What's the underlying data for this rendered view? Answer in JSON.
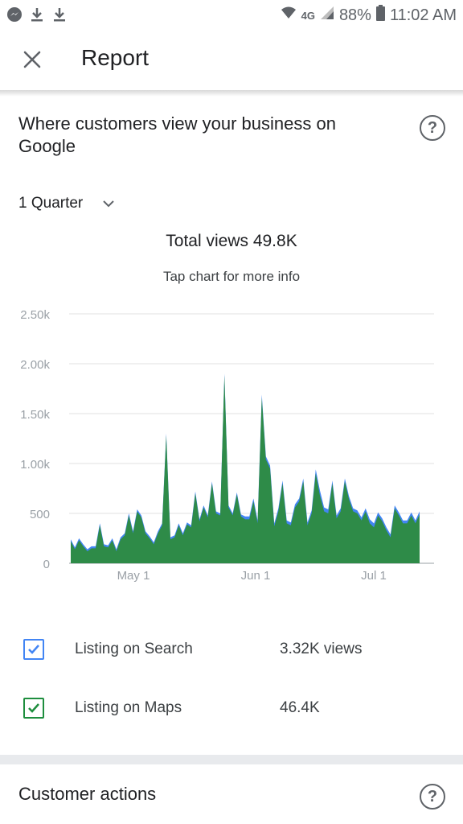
{
  "status_bar": {
    "battery": "88%",
    "time": "11:02 AM",
    "network": "4G",
    "left_icons": [
      "messenger-icon",
      "download-icon",
      "download-icon"
    ]
  },
  "header": {
    "title": "Report",
    "close_icon": "close-icon"
  },
  "card": {
    "title": "Where customers view your business on Google",
    "period": "1 Quarter",
    "total_views": "Total views 49.8K",
    "hint": "Tap chart for more info"
  },
  "legend": [
    {
      "label": "Listing on Search",
      "value": "3.32K views",
      "color": "#4285f4"
    },
    {
      "label": "Listing on Maps",
      "value": "46.4K",
      "color": "#1e8e3e"
    }
  ],
  "next_section": {
    "title": "Customer actions"
  },
  "chart_data": {
    "type": "area",
    "y_ticks": [
      "0",
      "500",
      "1.00k",
      "1.50k",
      "2.00k",
      "2.50k"
    ],
    "x_ticks": [
      "May 1",
      "Jun 1",
      "Jul 1"
    ],
    "ylim": [
      0,
      2500
    ],
    "grid": true,
    "series": [
      {
        "name": "Listing on Maps",
        "color": "#2e8b48",
        "values": [
          220,
          140,
          230,
          170,
          120,
          150,
          150,
          380,
          170,
          160,
          230,
          120,
          240,
          280,
          480,
          300,
          520,
          460,
          300,
          250,
          190,
          300,
          380,
          1280,
          240,
          260,
          380,
          280,
          390,
          360,
          700,
          420,
          560,
          460,
          800,
          500,
          480,
          1880,
          560,
          480,
          690,
          470,
          440,
          440,
          620,
          400,
          1660,
          1040,
          950,
          370,
          520,
          800,
          400,
          380,
          560,
          620,
          820,
          380,
          500,
          900,
          680,
          520,
          500,
          800,
          450,
          520,
          820,
          640,
          520,
          500,
          430,
          520,
          400,
          360,
          480,
          420,
          330,
          260,
          550,
          480,
          400,
          400,
          480,
          400,
          490
        ]
      },
      {
        "name": "Listing on Search",
        "color": "#4285f4",
        "values": [
          20,
          20,
          20,
          20,
          20,
          20,
          20,
          20,
          20,
          20,
          20,
          20,
          20,
          20,
          20,
          20,
          20,
          20,
          20,
          20,
          20,
          20,
          20,
          20,
          20,
          20,
          20,
          20,
          20,
          20,
          20,
          20,
          20,
          20,
          20,
          20,
          20,
          20,
          20,
          20,
          20,
          20,
          30,
          30,
          30,
          30,
          30,
          30,
          30,
          30,
          30,
          30,
          30,
          30,
          30,
          30,
          30,
          30,
          30,
          40,
          50,
          40,
          40,
          30,
          30,
          30,
          30,
          30,
          30,
          30,
          30,
          30,
          40,
          40,
          30,
          30,
          30,
          30,
          30,
          30,
          30,
          30,
          30,
          30,
          30
        ]
      }
    ]
  }
}
